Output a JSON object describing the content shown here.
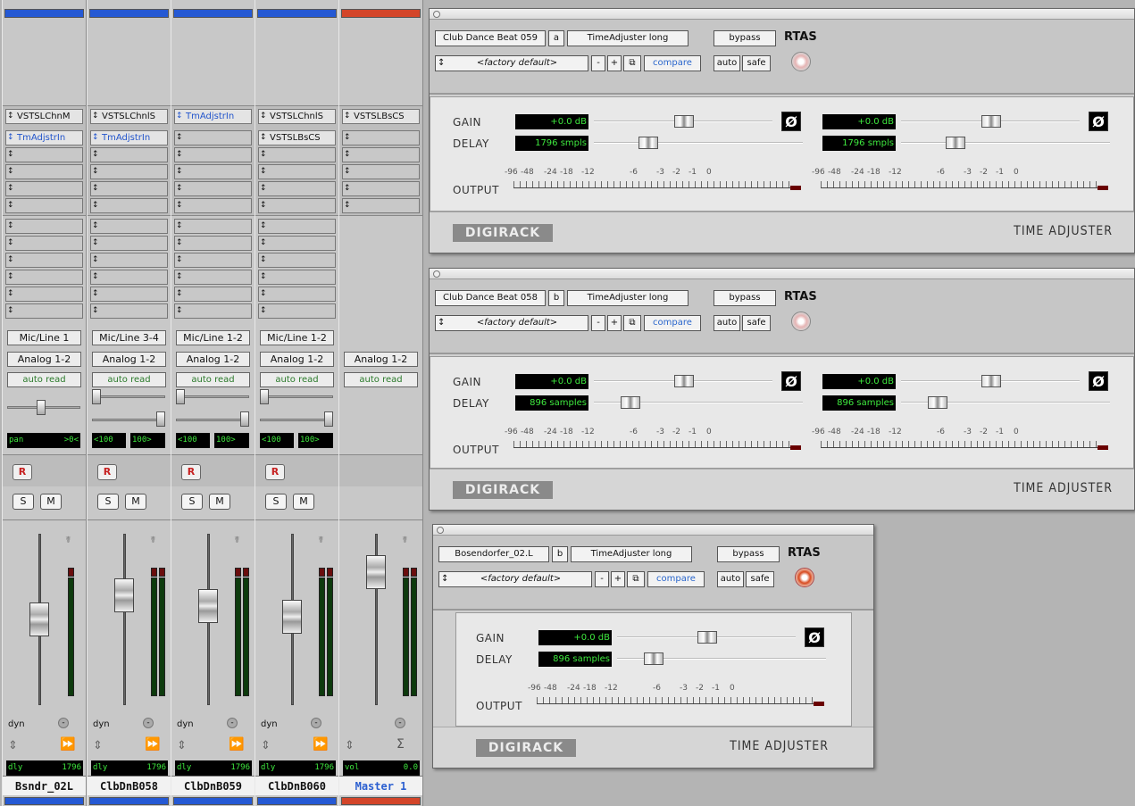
{
  "colors": {
    "blue": "#2559d4",
    "red": "#d34529",
    "lcd_green": "#3ee83e"
  },
  "mixer": {
    "channels": [
      {
        "name": "Bsndr_02L",
        "color": "blue",
        "inserts": [
          "VSTSLChnM",
          "TmAdjstrIn",
          "",
          "",
          "",
          ""
        ],
        "sends": [
          "",
          "",
          "",
          "",
          "",
          ""
        ],
        "input": "Mic/Line 1",
        "output": "Analog 1-2",
        "automation": "auto read",
        "pan": {
          "label": "pan",
          "value": ">0<"
        },
        "rec": "R",
        "solo": "S",
        "mute": "M",
        "dyn": "dyn",
        "readout": {
          "label": "dly",
          "value": "1796"
        },
        "send_icon": "fast-forward-icon"
      },
      {
        "name": "ClbDnB058",
        "color": "blue",
        "inserts": [
          "VSTSLChnlS",
          "TmAdjstrIn",
          "",
          "",
          "",
          ""
        ],
        "sends": [
          "",
          "",
          "",
          "",
          "",
          ""
        ],
        "input": "Mic/Line 3-4",
        "output": "Analog 1-2",
        "automation": "auto read",
        "pan": {
          "left": "<100",
          "right": "100>"
        },
        "rec": "R",
        "solo": "S",
        "mute": "M",
        "dyn": "dyn",
        "readout": {
          "label": "dly",
          "value": "1796"
        },
        "send_icon": "fast-forward-icon"
      },
      {
        "name": "ClbDnB059",
        "color": "blue",
        "inserts": [
          "TmAdjstrIn",
          "",
          "",
          "",
          "",
          ""
        ],
        "sends": [
          "",
          "",
          "",
          "",
          "",
          ""
        ],
        "input": "Mic/Line 1-2",
        "output": "Analog 1-2",
        "automation": "auto read",
        "pan": {
          "left": "<100",
          "right": "100>"
        },
        "rec": "R",
        "solo": "S",
        "mute": "M",
        "dyn": "dyn",
        "readout": {
          "label": "dly",
          "value": "1796"
        },
        "send_icon": "fast-forward-icon"
      },
      {
        "name": "ClbDnB060",
        "color": "blue",
        "inserts": [
          "VSTSLChnlS",
          "VSTSLBsCS",
          "",
          "",
          "",
          ""
        ],
        "sends": [
          "",
          "",
          "",
          "",
          "",
          ""
        ],
        "input": "Mic/Line 1-2",
        "output": "Analog 1-2",
        "automation": "auto read",
        "pan": {
          "left": "<100",
          "right": "100>"
        },
        "rec": "R",
        "solo": "S",
        "mute": "M",
        "dyn": "dyn",
        "readout": {
          "label": "dly",
          "value": "1796"
        },
        "send_icon": "fast-forward-icon"
      },
      {
        "name": "Master 1",
        "color": "red",
        "inserts": [
          "VSTSLBsCS",
          "",
          "",
          "",
          "",
          ""
        ],
        "output": "Analog 1-2",
        "automation": "auto read",
        "readout": {
          "label": "vol",
          "value": "0.0"
        },
        "send_icon": "sigma-icon"
      }
    ]
  },
  "plugins": [
    {
      "track": "Club Dance Beat 059",
      "channel": "a",
      "plugin": "TimeAdjuster long",
      "bypass": "bypass",
      "format": "RTAS",
      "preset": "<factory default>",
      "minus": "-",
      "plus": "+",
      "compare": "compare",
      "auto": "auto",
      "safe": "safe",
      "gain_label": "GAIN",
      "delay_label": "DELAY",
      "output_label": "OUTPUT",
      "gain": [
        "+0.0 dB",
        "+0.0 dB"
      ],
      "delay": [
        "1796 smpls",
        "1796 smpls"
      ],
      "phase": "Ø",
      "scale": [
        "-96",
        "-48",
        "-24",
        "-18",
        "-12",
        "-6",
        "-3",
        "-2",
        "-1",
        "0"
      ],
      "brand": "DIGIRACK",
      "title": "TIME ADJUSTER"
    },
    {
      "track": "Club Dance Beat 058",
      "channel": "b",
      "plugin": "TimeAdjuster long",
      "bypass": "bypass",
      "format": "RTAS",
      "preset": "<factory default>",
      "minus": "-",
      "plus": "+",
      "compare": "compare",
      "auto": "auto",
      "safe": "safe",
      "gain_label": "GAIN",
      "delay_label": "DELAY",
      "output_label": "OUTPUT",
      "gain": [
        "+0.0 dB",
        "+0.0 dB"
      ],
      "delay": [
        "896 samples",
        "896 samples"
      ],
      "phase": "Ø",
      "scale": [
        "-96",
        "-48",
        "-24",
        "-18",
        "-12",
        "-6",
        "-3",
        "-2",
        "-1",
        "0"
      ],
      "brand": "DIGIRACK",
      "title": "TIME ADJUSTER"
    },
    {
      "track": "Bosendorfer_02.L",
      "channel": "b",
      "plugin": "TimeAdjuster long",
      "bypass": "bypass",
      "format": "RTAS",
      "preset": "<factory default>",
      "minus": "-",
      "plus": "+",
      "compare": "compare",
      "auto": "auto",
      "safe": "safe",
      "gain_label": "GAIN",
      "delay_label": "DELAY",
      "output_label": "OUTPUT",
      "gain": [
        "+0.0 dB"
      ],
      "delay": [
        "896 samples"
      ],
      "phase": "Ø",
      "scale": [
        "-96",
        "-48",
        "-24",
        "-18",
        "-12",
        "-6",
        "-3",
        "-2",
        "-1",
        "0"
      ],
      "brand": "DIGIRACK",
      "title": "TIME ADJUSTER"
    }
  ]
}
